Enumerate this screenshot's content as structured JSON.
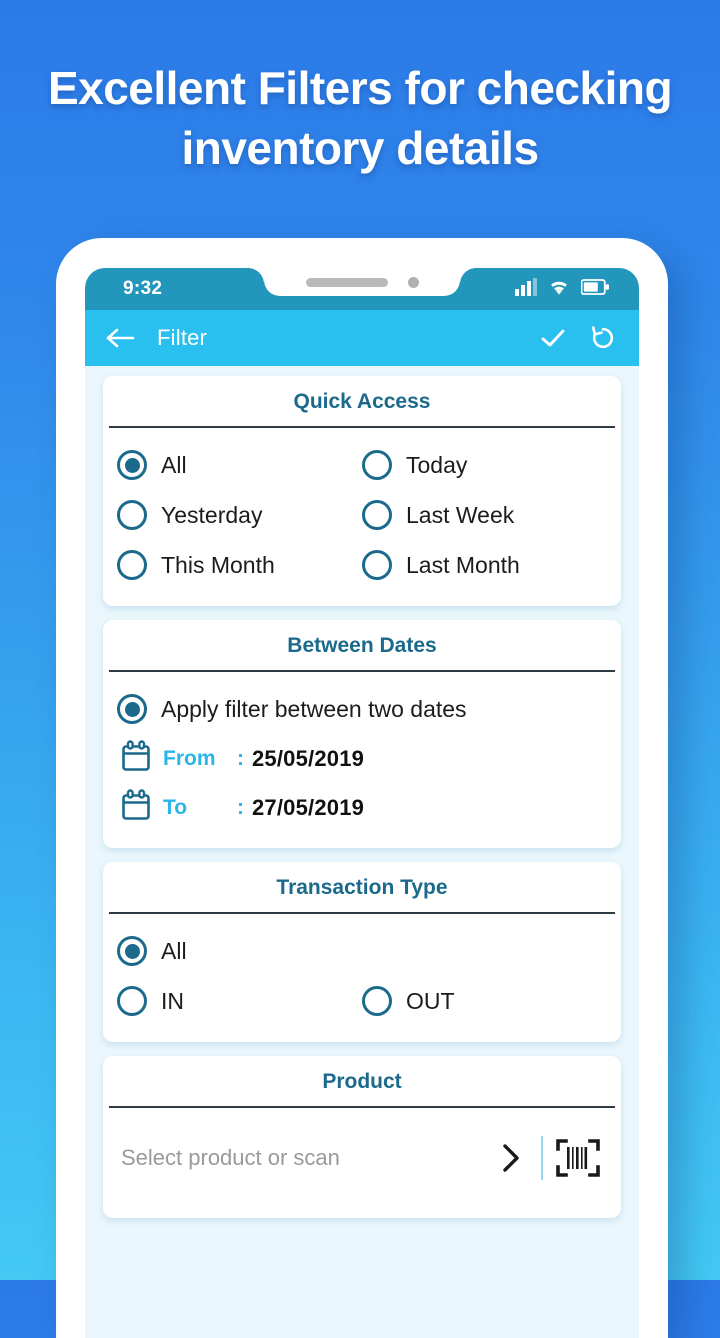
{
  "promo": {
    "line1": "Excellent Filters for checking",
    "line2": "inventory details"
  },
  "status_bar": {
    "time": "9:32",
    "icons": [
      "signal-icon",
      "wifi-icon",
      "battery-icon"
    ]
  },
  "appbar": {
    "back_icon": "back-arrow-icon",
    "title": "Filter",
    "apply_icon": "check-icon",
    "reset_icon": "reset-icon"
  },
  "cards": {
    "quick_access": {
      "title": "Quick Access",
      "options": [
        {
          "label": "All",
          "selected": true
        },
        {
          "label": "Today",
          "selected": false
        },
        {
          "label": "Yesterday",
          "selected": false
        },
        {
          "label": "Last Week",
          "selected": false
        },
        {
          "label": "This Month",
          "selected": false
        },
        {
          "label": "Last Month",
          "selected": false
        }
      ]
    },
    "between_dates": {
      "title": "Between Dates",
      "option_label": "Apply filter between two dates",
      "option_selected": true,
      "from_label": "From",
      "from_value": "25/05/2019",
      "to_label": "To",
      "to_value": "27/05/2019",
      "colon": ":"
    },
    "transaction_type": {
      "title": "Transaction Type",
      "options": [
        {
          "label": "All",
          "selected": true
        },
        {
          "label": "IN",
          "selected": false
        },
        {
          "label": "OUT",
          "selected": false
        }
      ]
    },
    "product": {
      "title": "Product",
      "placeholder": "Select product or scan",
      "chevron_icon": "chevron-right-icon",
      "scan_icon": "barcode-scan-icon"
    }
  },
  "colors": {
    "accent": "#29bfee",
    "statusbar": "#2396bb",
    "card_title": "#1b6a8c",
    "date_label": "#2bb6ea",
    "screen_bg": "#eaf7fd"
  }
}
